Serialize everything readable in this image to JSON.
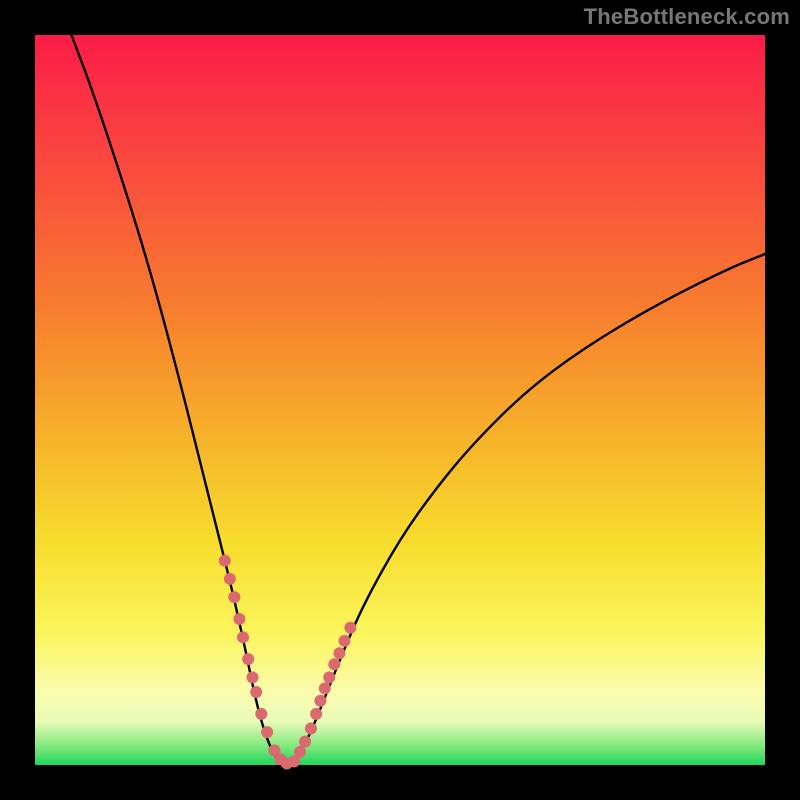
{
  "watermark": "TheBottleneck.com",
  "colors": {
    "background": "#000000",
    "gradient_top": "#fb1c47",
    "gradient_mid": "#f7de2e",
    "gradient_bottom": "#1fd65e",
    "curve": "#000000",
    "dots": "#da6a6f"
  },
  "chart_data": {
    "type": "line",
    "title": "",
    "xlabel": "",
    "ylabel": "",
    "xlim": [
      0,
      100
    ],
    "ylim": [
      0,
      100
    ],
    "note": "No axis tick labels are shown; x/y are normalized 0–100. y represents bottleneck % (0 = green/no bottleneck at bottom, 100 = red/severe at top). Curve minimum near x≈34.",
    "series": [
      {
        "name": "bottleneck-curve",
        "x": [
          5,
          8,
          12,
          16,
          20,
          23,
          25,
          27,
          29,
          30,
          31,
          32,
          33,
          34,
          35,
          36,
          37,
          38,
          40,
          42,
          45,
          50,
          55,
          60,
          67,
          75,
          85,
          95,
          100
        ],
        "y": [
          100,
          92,
          80,
          67,
          52,
          40,
          32,
          24,
          15,
          10,
          6,
          3,
          1,
          0,
          0,
          1,
          3,
          5,
          10,
          15,
          22,
          31,
          38,
          44,
          51,
          57,
          63,
          68,
          70
        ]
      }
    ],
    "highlight_dots": {
      "name": "sample-points",
      "x": [
        26.0,
        26.7,
        27.3,
        28.0,
        28.5,
        29.2,
        29.8,
        30.3,
        31.0,
        31.8,
        32.8,
        33.6,
        34.5,
        35.5,
        36.3,
        37.0,
        37.8,
        38.5,
        39.1,
        39.7,
        40.3,
        41.0,
        41.7,
        42.4,
        43.2
      ],
      "y": [
        28.0,
        25.5,
        23.0,
        20.0,
        17.5,
        14.5,
        12.0,
        10.0,
        7.0,
        4.5,
        2.0,
        0.8,
        0.2,
        0.5,
        1.8,
        3.2,
        5.0,
        7.0,
        8.8,
        10.5,
        12.0,
        13.8,
        15.3,
        17.0,
        18.8
      ]
    }
  }
}
